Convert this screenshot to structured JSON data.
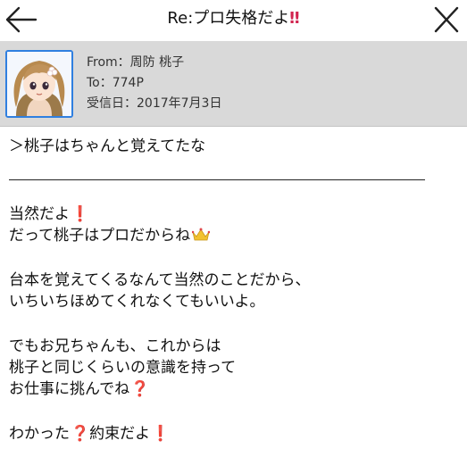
{
  "title": {
    "prefix": "Re:",
    "subject": "プロ失格だよ",
    "emoji": "‼"
  },
  "header": {
    "from": "From：周防 桃子",
    "to": "To：774P",
    "date": "受信日：2017年7月3日"
  },
  "message": {
    "quote": "＞桃子はちゃんと覚えてたな",
    "l1": "当然だよ",
    "l1_emoji": "❗",
    "l2": "だって桃子はプロだからね",
    "l2_emoji": "crown-icon",
    "l3": "台本を覚えてくるなんて当然のことだから、",
    "l4": "いちいちほめてくれなくてもいいよ。",
    "l5": "でもお兄ちゃんも、これからは",
    "l6": "桃子と同じくらいの意識を持って",
    "l7": "お仕事に挑んでね",
    "l7_emoji": "❓",
    "l8a": "わかった",
    "l8_emoji1": "❓",
    "l8b": "約束だよ",
    "l8_emoji2": "❗"
  },
  "colors": {
    "accent": "#2f7fe0",
    "emphasis": "#d1244f",
    "header_bg": "#d9d9d9"
  }
}
